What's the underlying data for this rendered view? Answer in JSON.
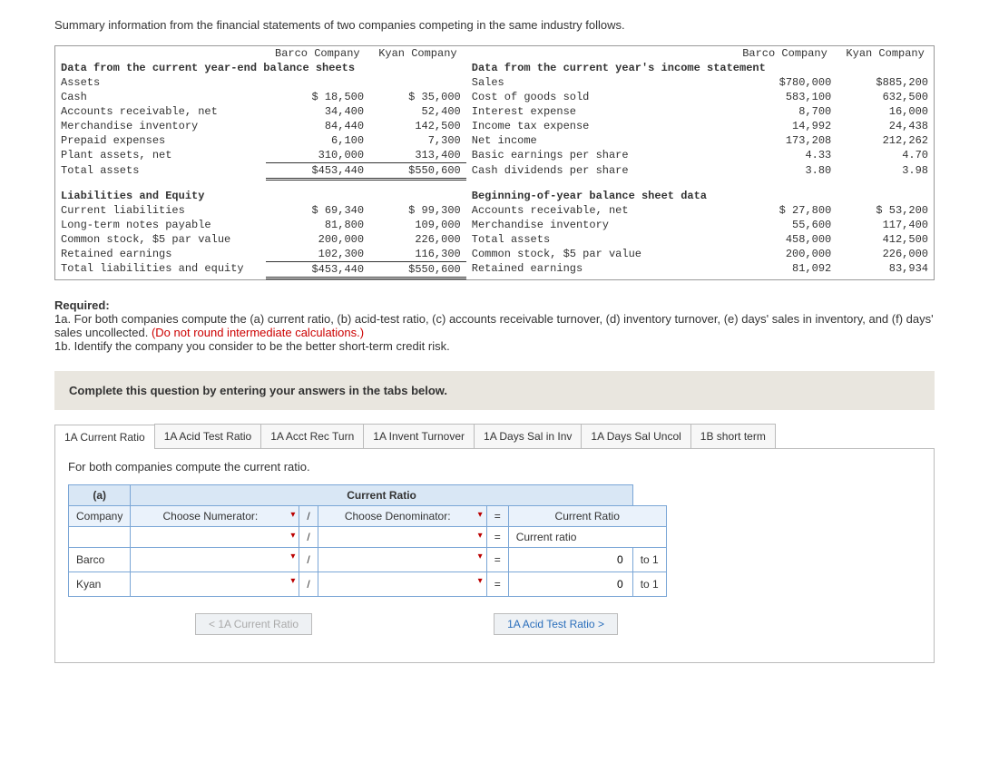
{
  "intro": "Summary information from the financial statements of two companies competing in the same industry follows.",
  "hdr": {
    "barco": "Barco Company",
    "kyan": "Kyan Company"
  },
  "left_title": "Data from the current year-end balance sheets",
  "right_title": "Data from the current year's income statement",
  "rows_left": {
    "assets_hdr": "Assets",
    "cash": {
      "lbl": "Cash",
      "b": "$ 18,500",
      "k": "$ 35,000"
    },
    "ar": {
      "lbl": "Accounts receivable, net",
      "b": "34,400",
      "k": "52,400"
    },
    "inv": {
      "lbl": "Merchandise inventory",
      "b": "84,440",
      "k": "142,500"
    },
    "pre": {
      "lbl": "Prepaid expenses",
      "b": "6,100",
      "k": "7,300"
    },
    "plant": {
      "lbl": "Plant assets, net",
      "b": "310,000",
      "k": "313,400"
    },
    "ta": {
      "lbl": "Total assets",
      "b": "$453,440",
      "k": "$550,600"
    },
    "le_hdr": "Liabilities and Equity",
    "cl": {
      "lbl": "Current liabilities",
      "b": "$ 69,340",
      "k": "$ 99,300"
    },
    "ltn": {
      "lbl": "Long-term notes payable",
      "b": "81,800",
      "k": "109,000"
    },
    "cs": {
      "lbl": "Common stock, $5 par value",
      "b": "200,000",
      "k": "226,000"
    },
    "re": {
      "lbl": "Retained earnings",
      "b": "102,300",
      "k": "116,300"
    },
    "tle": {
      "lbl": "Total liabilities and equity",
      "b": "$453,440",
      "k": "$550,600"
    }
  },
  "rows_right": {
    "sales": {
      "lbl": "Sales",
      "b": "$780,000",
      "k": "$885,200"
    },
    "cogs": {
      "lbl": "Cost of goods sold",
      "b": "583,100",
      "k": "632,500"
    },
    "intexp": {
      "lbl": "Interest expense",
      "b": "8,700",
      "k": "16,000"
    },
    "tax": {
      "lbl": "Income tax expense",
      "b": "14,992",
      "k": "24,438"
    },
    "ni": {
      "lbl": "Net income",
      "b": "173,208",
      "k": "212,262"
    },
    "beps": {
      "lbl": "Basic earnings per share",
      "b": "4.33",
      "k": "4.70"
    },
    "cdps": {
      "lbl": "Cash dividends per share",
      "b": "3.80",
      "k": "3.98"
    },
    "boy_hdr": "Beginning-of-year balance sheet data",
    "boy_ar": {
      "lbl": "Accounts receivable, net",
      "b": "$ 27,800",
      "k": "$ 53,200"
    },
    "boy_inv": {
      "lbl": "Merchandise inventory",
      "b": "55,600",
      "k": "117,400"
    },
    "boy_ta": {
      "lbl": "Total assets",
      "b": "458,000",
      "k": "412,500"
    },
    "boy_cs": {
      "lbl": "Common stock, $5 par value",
      "b": "200,000",
      "k": "226,000"
    },
    "boy_re": {
      "lbl": "Retained earnings",
      "b": "81,092",
      "k": "83,934"
    }
  },
  "req": {
    "title": "Required:",
    "a": "1a. For both companies compute the (a) current ratio, (b) acid-test ratio, (c) accounts receivable turnover, (d) inventory turnover, (e) days' sales in inventory, and (f) days' sales uncollected. ",
    "a_red": "(Do not round intermediate calculations.)",
    "b": "1b. Identify the company you consider to be the better short-term credit risk."
  },
  "tabs_instr": "Complete this question by entering your answers in the tabs below.",
  "tabs": {
    "t1": "1A Current Ratio",
    "t2": "1A Acid Test Ratio",
    "t3": "1A Acct Rec Turn",
    "t4": "1A Invent Turnover",
    "t5": "1A Days Sal in Inv",
    "t6": "1A Days Sal Uncol",
    "t7": "1B short term"
  },
  "panel": {
    "desc": "For both companies compute the current ratio.",
    "title": "Current Ratio",
    "col_a": "(a)",
    "col_comp": "Company",
    "col_num": "Choose Numerator:",
    "col_slash": "/",
    "col_den": "Choose Denominator:",
    "col_eq": "=",
    "col_res": "Current Ratio",
    "row_generic": "Current ratio",
    "barco": "Barco",
    "kyan": "Kyan",
    "zero": "0",
    "to1": "to 1"
  },
  "nav": {
    "prev": "1A Current Ratio",
    "next": "1A Acid Test Ratio"
  }
}
